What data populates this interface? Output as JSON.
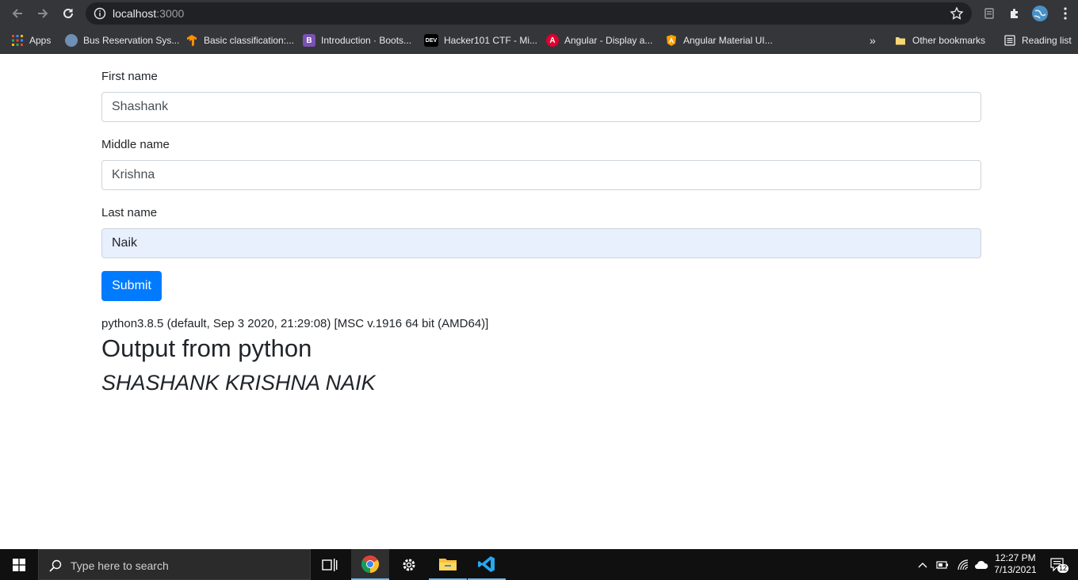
{
  "browser": {
    "url_host": "localhost",
    "url_port": ":3000",
    "bookmarks": [
      {
        "label": "Apps",
        "icon": "apps-grid-icon"
      },
      {
        "label": "Bus Reservation Sys...",
        "icon": "bus-reservation-favicon"
      },
      {
        "label": "Basic classification:...",
        "icon": "tensorflow-favicon"
      },
      {
        "label": "Introduction · Boots...",
        "icon": "bootstrap-favicon",
        "fav_text": "B"
      },
      {
        "label": "Hacker101 CTF - Mi...",
        "icon": "dev-favicon",
        "fav_text": "DEV"
      },
      {
        "label": "Angular - Display a...",
        "icon": "angular-favicon",
        "fav_text": "A"
      },
      {
        "label": "Angular Material UI...",
        "icon": "angular-material-favicon"
      }
    ],
    "overflow_label": "»",
    "other_bookmarks": "Other bookmarks",
    "reading_list": "Reading list"
  },
  "form": {
    "first_name_label": "First name",
    "first_name_value": "Shashank",
    "middle_name_label": "Middle name",
    "middle_name_value": "Krishna",
    "last_name_label": "Last name",
    "last_name_value": "Naik",
    "submit_label": "Submit"
  },
  "output": {
    "python_version": "python3.8.5 (default, Sep 3 2020, 21:29:08) [MSC v.1916 64 bit (AMD64)]",
    "heading": "Output from python",
    "result": "SHASHANK KRISHNA NAIK"
  },
  "taskbar": {
    "search_placeholder": "Type here to search",
    "time": "12:27 PM",
    "date": "7/13/2021",
    "notification_count": "12"
  },
  "colors": {
    "accent": "#007bff",
    "autofill_bg": "#e8f0fe",
    "browser_chrome": "#35363a"
  }
}
